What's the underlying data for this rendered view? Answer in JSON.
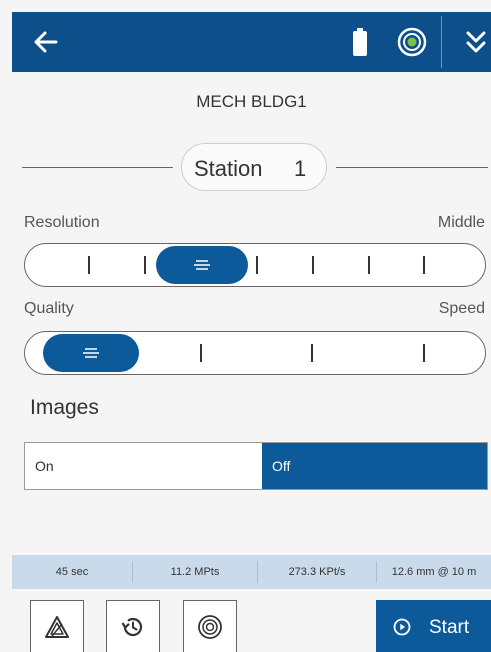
{
  "header": {
    "back_icon": "arrow-left-icon",
    "battery_icon": "battery-icon",
    "target_icon": "target-icon",
    "menu_icon": "double-chevron-down-icon",
    "color": "#0d4f8b"
  },
  "project": {
    "name": "MECH BLDG1"
  },
  "station": {
    "label": "Station",
    "number": "1"
  },
  "resolution": {
    "label": "Resolution",
    "value": "Middle",
    "steps": 7,
    "selected_step": 3
  },
  "quality": {
    "label": "Quality",
    "value": "Speed",
    "steps": 4,
    "selected_step": 1
  },
  "images": {
    "label": "Images",
    "options": [
      "On",
      "Off"
    ],
    "selected": "Off"
  },
  "stats": [
    {
      "value": "45 sec"
    },
    {
      "value": "11.2 MPts"
    },
    {
      "value": "273.3 KPt/s"
    },
    {
      "value": "12.6 mm @ 10 m"
    }
  ],
  "toolbar": {
    "tools": [
      "tilt-warning-icon",
      "history-icon",
      "target-icon"
    ],
    "start_label": "Start",
    "start_icon": "play-circle-icon"
  },
  "colors": {
    "accent": "#0d5a9a",
    "stats_background": "#c9daea"
  }
}
